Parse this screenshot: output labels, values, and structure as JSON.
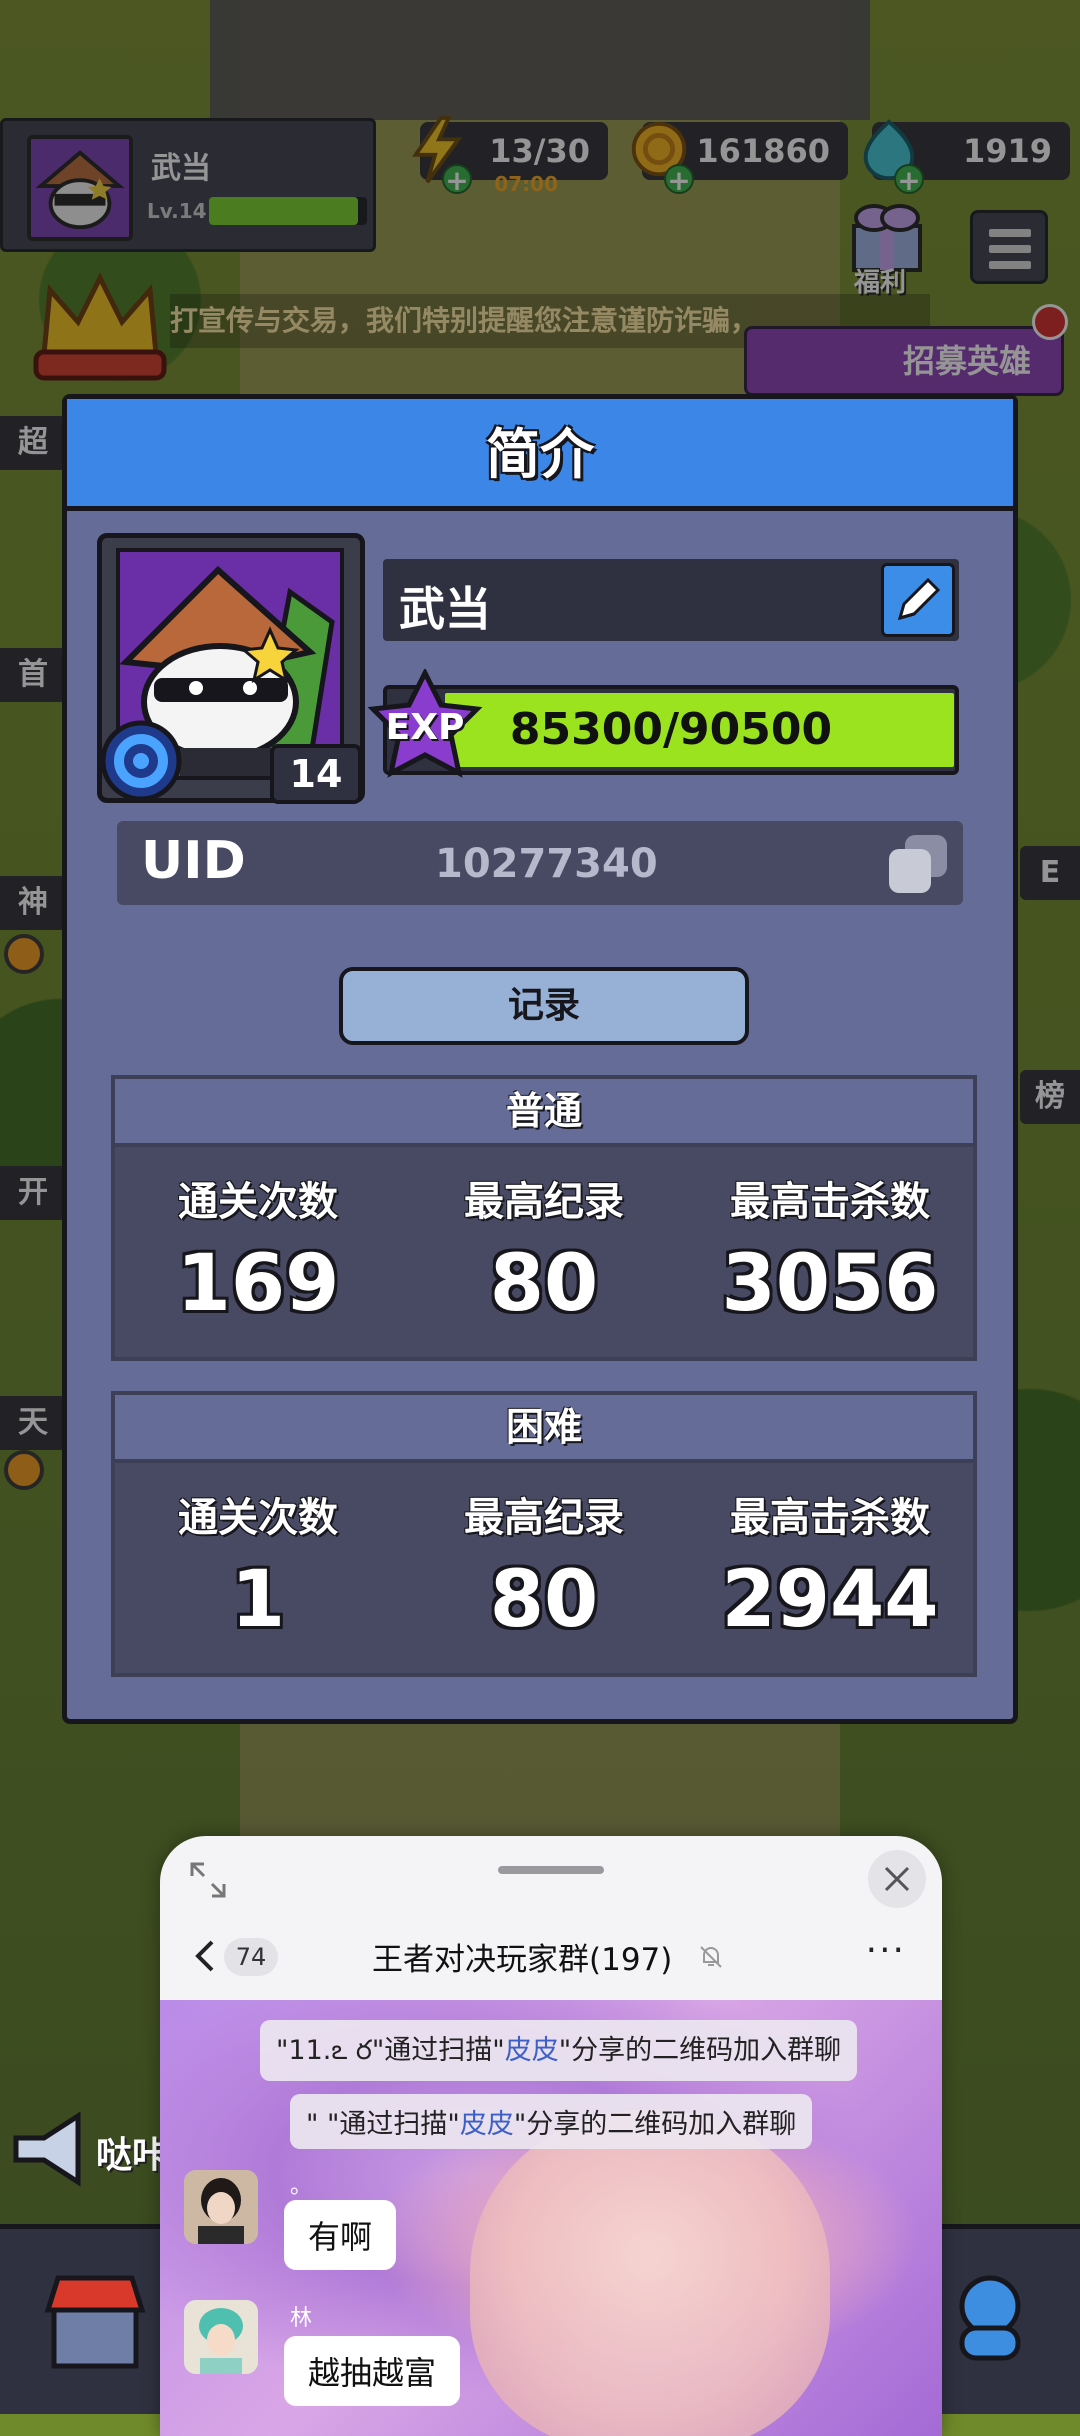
{
  "player": {
    "name": "武当",
    "level_label": "Lv.14",
    "level_progress": 0.943
  },
  "resources": {
    "energy": "13/30",
    "energy_timer": "07:00",
    "gold": "161860",
    "gems": "1919"
  },
  "top_buttons": {
    "welfare_label": "福利",
    "recruit_label": "招募英雄"
  },
  "marquee_text": "打宣传与交易，我们特别提醒您注意谨防诈骗，",
  "side_labels_left": [
    "超",
    "首",
    "神",
    "开",
    "天"
  ],
  "side_labels_right": [
    "E",
    "榜"
  ],
  "profile_dialog": {
    "title": "简介",
    "name": "武当",
    "level": "14",
    "exp_label": "EXP",
    "exp_text": "85300/90500",
    "exp_current": 85300,
    "exp_max": 90500,
    "uid_label": "UID",
    "uid_value": "10277340",
    "record_button": "记录",
    "normal": {
      "header": "普通",
      "clears_label": "通关次数",
      "best_label": "最高纪录",
      "kills_label": "最高击杀数",
      "clears": "169",
      "best": "80",
      "kills": "3056"
    },
    "hard": {
      "header": "困难",
      "clears_label": "通关次数",
      "best_label": "最高纪录",
      "kills_label": "最高击杀数",
      "clears": "1",
      "best": "80",
      "kills": "2944"
    }
  },
  "announcement_label": "哒咔",
  "chat": {
    "unread_badge": "74",
    "title": "王者对决玩家群(197)",
    "more": "···",
    "system_messages": [
      {
        "prefix": "\"11.",
        "mid": "ఽ ర\"通过扫描\"",
        "highlight": "皮皮",
        "suffix": "\"分享的二维码加入群聊"
      },
      {
        "prefix": "\"",
        "mid": "  \"通过扫描\"",
        "highlight": "皮皮",
        "suffix": "\"分享的二维码加入群聊"
      }
    ],
    "messages": [
      {
        "nick": "。",
        "text": "有啊"
      },
      {
        "nick": "林",
        "text": "越抽越富"
      }
    ]
  },
  "colors": {
    "dialog_bg": "#656c97",
    "header_blue": "#3b86e6",
    "exp_green": "#9be31f",
    "panel_bg": "#474a62"
  }
}
